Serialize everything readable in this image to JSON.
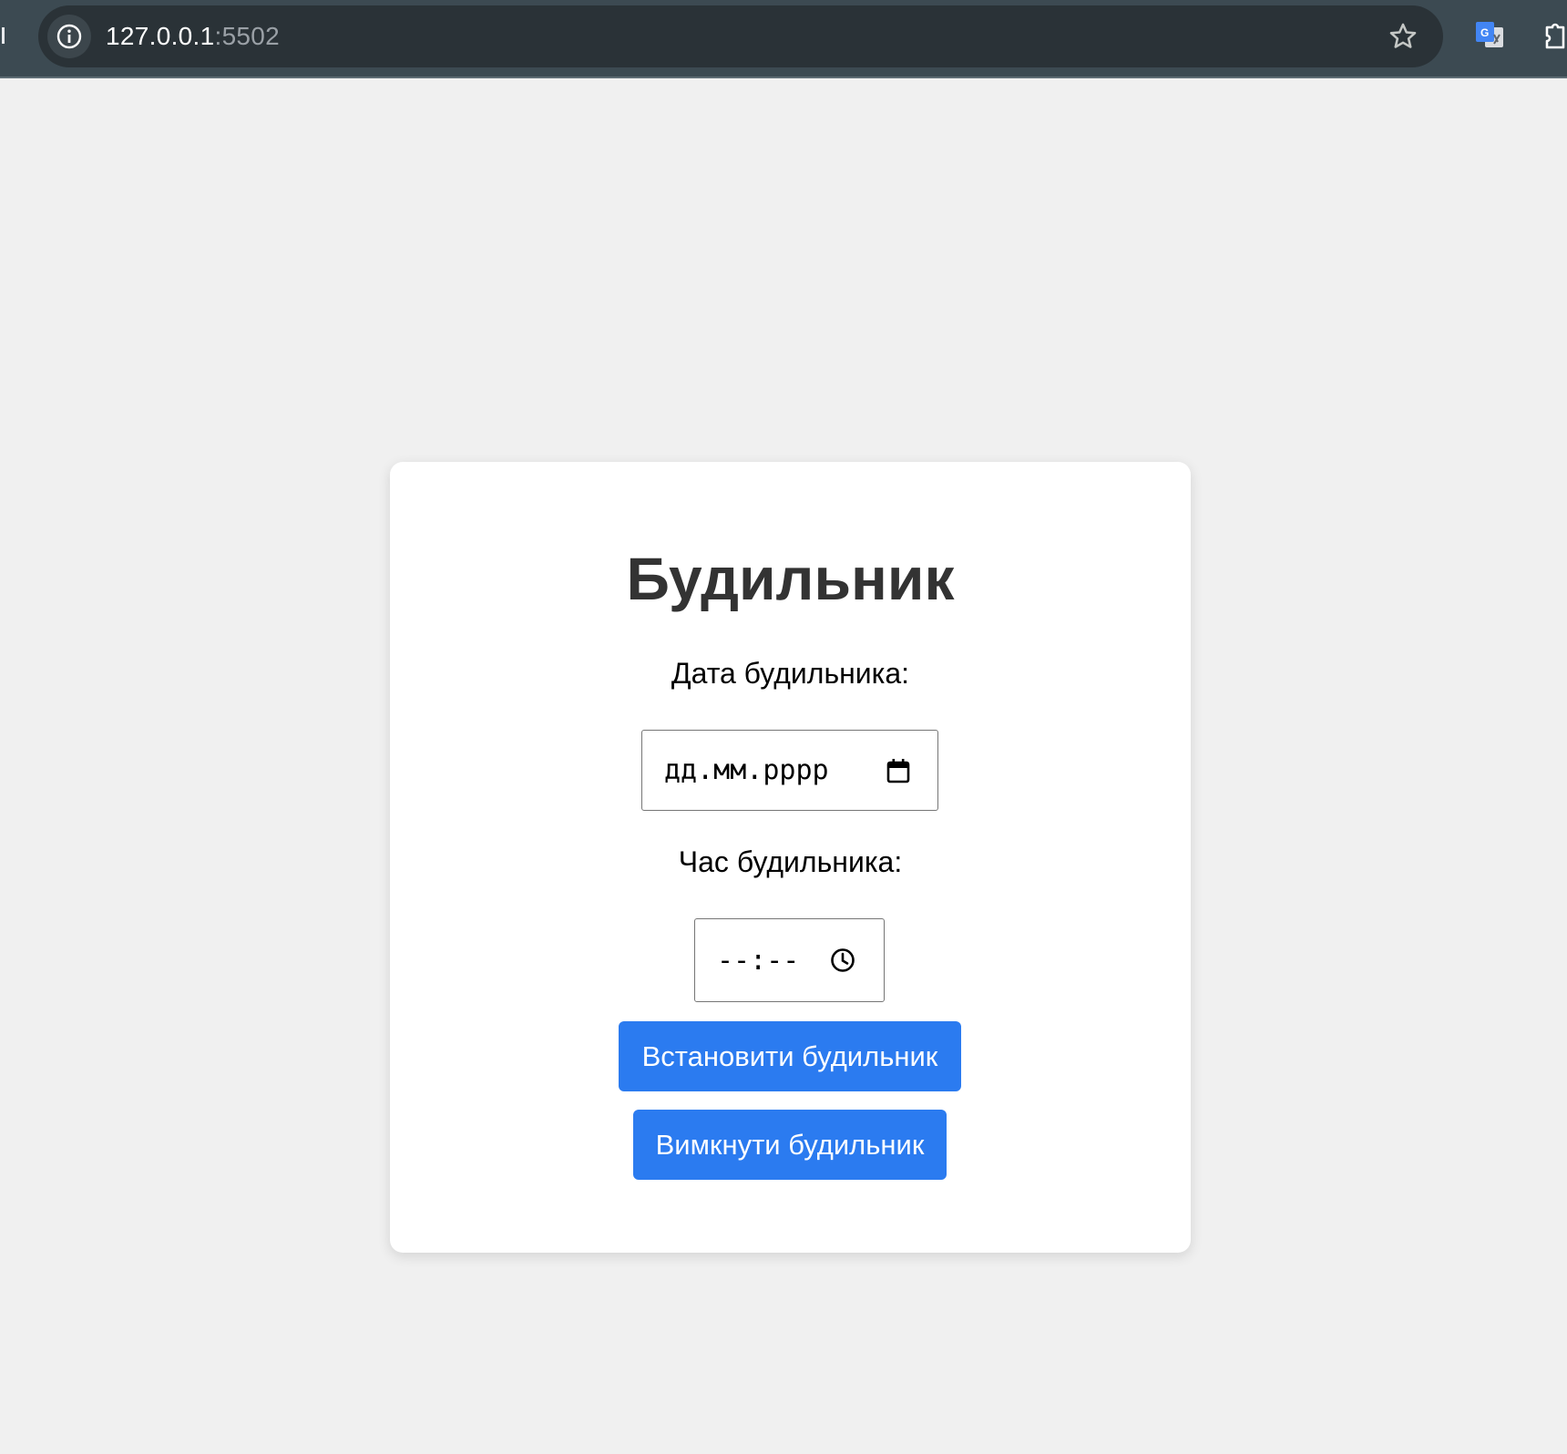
{
  "browser": {
    "url_host": "127.0.0.1",
    "url_port": ":5502"
  },
  "page": {
    "title": "Будильник",
    "date_label": "Дата будильника:",
    "date_placeholder": "дд.мм.рррр",
    "time_label": "Час будильника:",
    "time_placeholder": "--:--",
    "set_button": "Встановити будильник",
    "off_button": "Вимкнути будильник"
  },
  "colors": {
    "page_background": "#f0f0f0",
    "card_background": "#ffffff",
    "button_background": "#2b7bf0",
    "title_text": "#333333",
    "browser_bar": "#3c4a52"
  },
  "icons": {
    "site_info": "info-icon",
    "bookmark": "star-icon",
    "extension_1": "google-translate-icon",
    "extension_2": "puzzle-icon",
    "date_picker": "calendar-icon",
    "time_picker": "clock-icon"
  }
}
